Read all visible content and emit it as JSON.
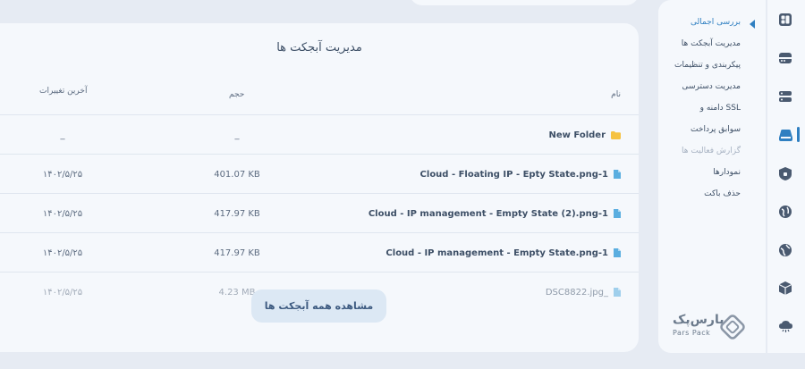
{
  "card": {
    "title": "مدیریت آبجکت ها",
    "columns": {
      "name": "نام",
      "size": "حجم",
      "modified": "آخرین تغییرات"
    },
    "rows": [
      {
        "name": "New Folder",
        "type": "folder",
        "size": "_",
        "modified": "_"
      },
      {
        "name": "Cloud - Floating IP - Epty State.png-1",
        "type": "file",
        "size": "401.07 KB",
        "modified": "۱۴۰۲/۵/۲۵"
      },
      {
        "name": "Cloud - IP management - Empty State (2).png-1",
        "type": "file",
        "size": "417.97 KB",
        "modified": "۱۴۰۲/۵/۲۵"
      },
      {
        "name": "Cloud - IP management - Empty State.png-1",
        "type": "file",
        "size": "417.97 KB",
        "modified": "۱۴۰۲/۵/۲۵"
      },
      {
        "name": "DSC8822.jpg_",
        "type": "file",
        "size": "4.23 MB",
        "modified": "۱۴۰۲/۵/۲۵"
      }
    ],
    "view_all_label": "مشاهده همه آبجکت ها"
  },
  "menu": {
    "items": [
      {
        "label": "بررسی اجمالی",
        "state": "active"
      },
      {
        "label": "مدیریت آبجکت ها",
        "state": "normal"
      },
      {
        "label": "پیکربندی و تنظیمات",
        "state": "normal"
      },
      {
        "label": "مدیریت دسترسی",
        "state": "normal"
      },
      {
        "label": "دامنه و SSL",
        "state": "normal"
      },
      {
        "label": "سوابق پرداخت",
        "state": "normal"
      },
      {
        "label": "گزارش فعالیت ها",
        "state": "disabled"
      },
      {
        "label": "نمودارها",
        "state": "normal"
      },
      {
        "label": "حذف باکت",
        "state": "normal"
      }
    ]
  },
  "rail": {
    "icons": [
      "dashboard-icon",
      "server-icon",
      "server-stack-icon",
      "cloud-storage-icon",
      "shield-icon",
      "globe-icon",
      "globe-alt-icon",
      "box-icon",
      "cloud-settings-icon"
    ]
  },
  "logo": {
    "fa": "پارس‌پک",
    "en": "Pars Pack"
  },
  "colors": {
    "accent": "#2f7fc1",
    "folder": "#f5c242",
    "file": "#5aaee0",
    "bg": "#e6ebf3",
    "panel": "#f5f8fc"
  }
}
